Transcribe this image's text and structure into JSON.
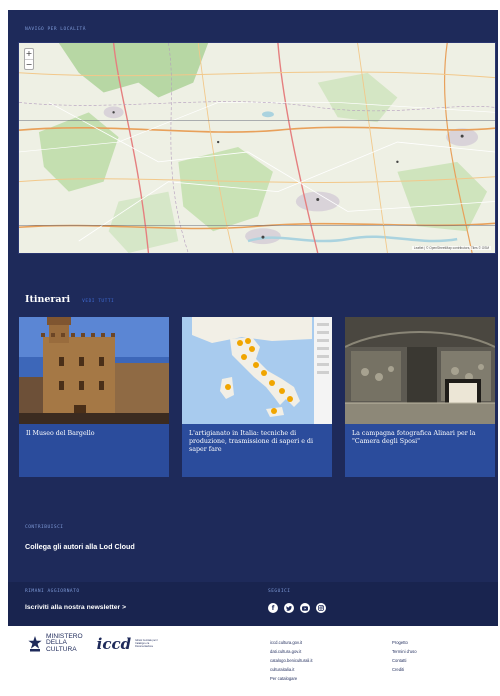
{
  "map": {
    "label": "Navigo per località",
    "zoom_in": "+",
    "zoom_out": "−",
    "attribution": "Leaflet | © OpenStreetMap contributors, Tiles © OSM"
  },
  "itinerari": {
    "title": "Itinerari",
    "see_all": "Vedi tutti",
    "cards": [
      {
        "title": "Il Museo del Bargello"
      },
      {
        "title": "L'artigianato in Italia: tecniche di produzione, trasmissione di saperi e di saper fare"
      },
      {
        "title": "La campagna fotografica Alinari per la \"Camera degli Sposi\""
      }
    ]
  },
  "contribuisci": {
    "label": "Contribuisci",
    "link": "Collega gli autori alla Lod Cloud"
  },
  "newsletter": {
    "label": "Rimani aggiornato",
    "link": "Iscriviti alla nostra newsletter >"
  },
  "seguici": {
    "label": "Seguici",
    "icons": [
      "facebook-icon",
      "twitter-icon",
      "youtube-icon",
      "instagram-icon"
    ]
  },
  "footer": {
    "ministero": [
      "MINISTERO",
      "DELLA",
      "CULTURA"
    ],
    "icid": "iccd",
    "icid_sub": "Istituto Centrale per il Catalogo e la Documentazione",
    "links_col1": [
      "iccd.cultura.gov.it",
      "dati.cultura.gov.it",
      "catalogo.beniculturali.it",
      "culturaitalia.it",
      "Per catalogare"
    ],
    "links_col2": [
      "Progetto",
      "Termini d'uso",
      "Contatti",
      "Crediti"
    ]
  },
  "colors": {
    "navy": "#1e2a5a",
    "card_blue": "#2b4c9c",
    "accent": "#3f6ad2"
  }
}
